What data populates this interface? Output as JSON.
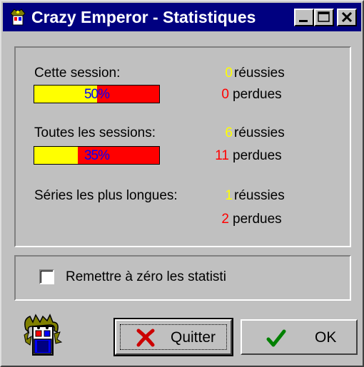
{
  "window": {
    "title": "Crazy Emperor - Statistiques",
    "icon": "crazy-emperor-app-icon",
    "controls": [
      "minimize-icon",
      "maximize-icon",
      "close-icon"
    ]
  },
  "stats": {
    "session": {
      "label": "Cette session:",
      "percent_label": "50%",
      "percent": 50,
      "won_count": "0",
      "won_label": "réussies",
      "lost_count": "0",
      "lost_label": "perdues"
    },
    "all_sessions": {
      "label": "Toutes les sessions:",
      "percent_label": "35%",
      "percent": 35,
      "won_count": "6",
      "won_label": "réussies",
      "lost_count": "11",
      "lost_label": "perdues"
    },
    "longest_streaks": {
      "label": "Séries les plus longues:",
      "won_count": "1",
      "won_label": "réussies",
      "lost_count": "2",
      "lost_label": "perdues"
    }
  },
  "reset": {
    "label": "Remettre à zéro les statisti",
    "checked": false
  },
  "buttons": {
    "quit_label": "Quitter",
    "ok_label": "OK"
  },
  "colors": {
    "title_bar": "#000080",
    "won": "#ffff00",
    "lost": "#ff0000",
    "percent_text": "#0000ff",
    "ok_check": "#008000",
    "quit_x": "#cc0000"
  }
}
